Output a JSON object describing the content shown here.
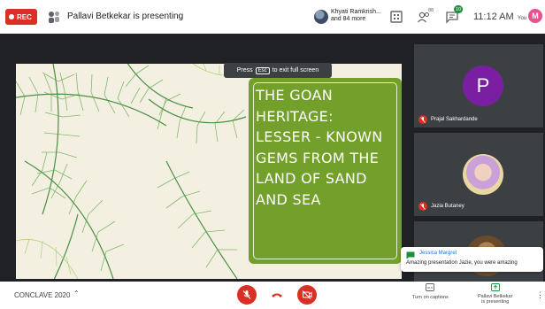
{
  "top_bar": {
    "rec_label": "REC",
    "presenting_text": "Pallavi Betkekar is presenting",
    "speakers_line1": "Khyati Ramkrish...",
    "speakers_line2": "and 84 more",
    "participant_count": "88",
    "chat_badge": "10",
    "time": "11:12 AM",
    "you_label": "You",
    "you_initial": "M"
  },
  "esc_tip": {
    "before": "Press",
    "key": "Esc",
    "after": "to exit full screen"
  },
  "slide": {
    "title_lines": [
      "THE GOAN",
      "HERITAGE:",
      "LESSER - KNOWN",
      "GEMS FROM THE",
      "LAND OF SAND",
      "AND  SEA"
    ]
  },
  "participants": [
    {
      "name": "Prajal Sakhardande",
      "initial": "P",
      "muted": true
    },
    {
      "name": "Jazia Butaney",
      "muted": true
    }
  ],
  "chat_toast": {
    "sender": "Jessica Margret",
    "message": "Amazing presentation Jazie, you were amazing"
  },
  "bottom_bar": {
    "meeting_name": "CONCLAVE 2020",
    "captions_label": "Turn on captions",
    "presenting_label_1": "Pallavi Betkekar",
    "presenting_label_2": "is presenting"
  },
  "colors": {
    "accent_red": "#d93025",
    "slide_green": "#73a02a",
    "avatar_purple": "#7b1fa2",
    "you_pink": "#e8508e"
  }
}
